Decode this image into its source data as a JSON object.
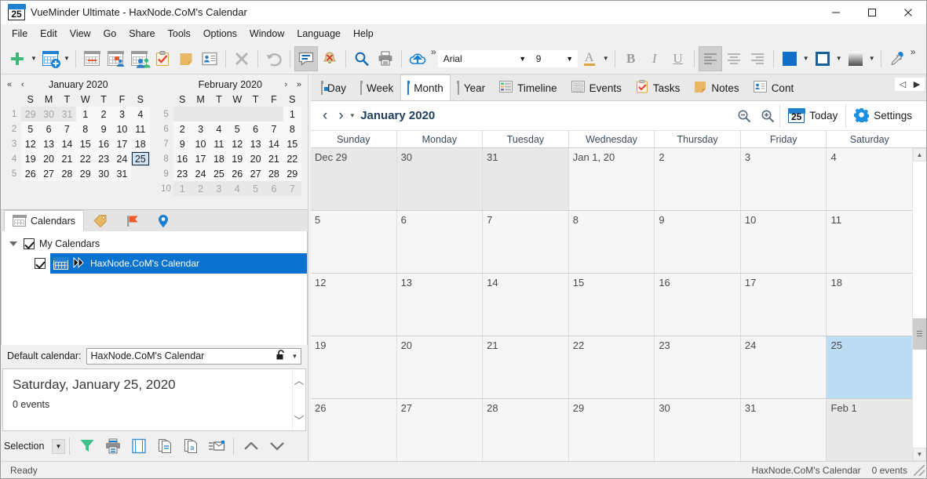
{
  "window": {
    "title": "VueMinder Ultimate - HaxNode.CoM's Calendar",
    "app_icon_number": "25",
    "minimize": "—",
    "maximize": "☐",
    "close": "✕"
  },
  "menu": {
    "items": [
      "File",
      "Edit",
      "View",
      "Go",
      "Share",
      "Tools",
      "Options",
      "Window",
      "Language",
      "Help"
    ]
  },
  "toolbar": {
    "font_name": "Arial",
    "font_size": "9",
    "overflow_label": "»",
    "buttons": [
      {
        "name": "new-item-button",
        "icon": "plus-icon"
      },
      {
        "name": "new-item-dropdown",
        "icon": "chevron-down-icon"
      },
      {
        "name": "new-calendar-button",
        "icon": "calendar-add-icon"
      },
      {
        "name": "new-calendar-dropdown",
        "icon": "chevron-down-icon"
      },
      {
        "name": "new-event-button",
        "icon": "calendar-event-icon"
      },
      {
        "name": "new-task-button",
        "icon": "calendar-task-icon"
      },
      {
        "name": "new-contact-group-button",
        "icon": "calendar-people-icon"
      },
      {
        "name": "new-task-list-button",
        "icon": "clipboard-check-icon"
      },
      {
        "name": "new-note-button",
        "icon": "sticky-note-icon"
      },
      {
        "name": "new-contact-button",
        "icon": "contact-card-icon"
      },
      {
        "name": "delete-button",
        "icon": "delete-x-icon"
      },
      {
        "name": "undo-button",
        "icon": "undo-arrow-icon"
      },
      {
        "name": "reminders-button",
        "icon": "speech-balloon-icon"
      },
      {
        "name": "dismiss-alarm-button",
        "icon": "bell-cancel-icon"
      },
      {
        "name": "search-button",
        "icon": "magnifier-icon"
      },
      {
        "name": "print-button",
        "icon": "printer-icon"
      },
      {
        "name": "sync-upload-button",
        "icon": "cloud-upload-icon"
      },
      {
        "name": "font-color-button",
        "icon": "font-color-A-icon"
      },
      {
        "name": "bold-button",
        "icon": "bold-B-icon"
      },
      {
        "name": "italic-button",
        "icon": "italic-I-icon"
      },
      {
        "name": "underline-button",
        "icon": "underline-U-icon"
      },
      {
        "name": "align-left-button",
        "icon": "align-left-icon"
      },
      {
        "name": "align-center-button",
        "icon": "align-center-icon"
      },
      {
        "name": "align-right-button",
        "icon": "align-right-icon"
      },
      {
        "name": "fill-color-button",
        "icon": "fill-color-swatch-icon"
      },
      {
        "name": "border-color-button",
        "icon": "border-color-swatch-icon"
      },
      {
        "name": "gradient-button",
        "icon": "gradient-swatch-icon"
      },
      {
        "name": "eyedropper-button",
        "icon": "eyedropper-icon"
      }
    ],
    "labels": {
      "bold": "B",
      "italic": "I",
      "underline": "U",
      "font_color": "A"
    }
  },
  "minicalendars": {
    "nav": {
      "prev_year": "«",
      "prev_month": "‹",
      "next_month": "›",
      "next_year": "»"
    },
    "dow": [
      "S",
      "M",
      "T",
      "W",
      "T",
      "F",
      "S"
    ],
    "months": [
      {
        "title": "January 2020",
        "weeks": [
          {
            "num": "1",
            "days": [
              {
                "t": "29",
                "s": "other"
              },
              {
                "t": "30",
                "s": "other"
              },
              {
                "t": "31",
                "s": "other"
              },
              {
                "t": "1",
                "s": "d"
              },
              {
                "t": "2",
                "s": "d"
              },
              {
                "t": "3",
                "s": "d"
              },
              {
                "t": "4",
                "s": "d"
              }
            ]
          },
          {
            "num": "2",
            "days": [
              {
                "t": "5",
                "s": "d"
              },
              {
                "t": "6",
                "s": "d"
              },
              {
                "t": "7",
                "s": "d"
              },
              {
                "t": "8",
                "s": "d"
              },
              {
                "t": "9",
                "s": "d"
              },
              {
                "t": "10",
                "s": "d"
              },
              {
                "t": "11",
                "s": "d"
              }
            ]
          },
          {
            "num": "3",
            "days": [
              {
                "t": "12",
                "s": "d"
              },
              {
                "t": "13",
                "s": "d"
              },
              {
                "t": "14",
                "s": "d"
              },
              {
                "t": "15",
                "s": "d"
              },
              {
                "t": "16",
                "s": "d"
              },
              {
                "t": "17",
                "s": "d"
              },
              {
                "t": "18",
                "s": "d"
              }
            ]
          },
          {
            "num": "4",
            "days": [
              {
                "t": "19",
                "s": "d"
              },
              {
                "t": "20",
                "s": "d"
              },
              {
                "t": "21",
                "s": "d"
              },
              {
                "t": "22",
                "s": "d"
              },
              {
                "t": "23",
                "s": "d"
              },
              {
                "t": "24",
                "s": "d"
              },
              {
                "t": "25",
                "s": "today"
              }
            ]
          },
          {
            "num": "5",
            "days": [
              {
                "t": "26",
                "s": "d"
              },
              {
                "t": "27",
                "s": "d"
              },
              {
                "t": "28",
                "s": "d"
              },
              {
                "t": "29",
                "s": "d"
              },
              {
                "t": "30",
                "s": "d"
              },
              {
                "t": "31",
                "s": "d"
              },
              {
                "t": "",
                "s": "empty"
              }
            ]
          }
        ]
      },
      {
        "title": "February 2020",
        "weeks": [
          {
            "num": "5",
            "days": [
              {
                "t": "",
                "s": "blank"
              },
              {
                "t": "",
                "s": "blank"
              },
              {
                "t": "",
                "s": "blank"
              },
              {
                "t": "",
                "s": "blank"
              },
              {
                "t": "",
                "s": "blank"
              },
              {
                "t": "",
                "s": "blank"
              },
              {
                "t": "1",
                "s": "d"
              }
            ]
          },
          {
            "num": "6",
            "days": [
              {
                "t": "2",
                "s": "d"
              },
              {
                "t": "3",
                "s": "d"
              },
              {
                "t": "4",
                "s": "d"
              },
              {
                "t": "5",
                "s": "d"
              },
              {
                "t": "6",
                "s": "d"
              },
              {
                "t": "7",
                "s": "d"
              },
              {
                "t": "8",
                "s": "d"
              }
            ]
          },
          {
            "num": "7",
            "days": [
              {
                "t": "9",
                "s": "d"
              },
              {
                "t": "10",
                "s": "d"
              },
              {
                "t": "11",
                "s": "d"
              },
              {
                "t": "12",
                "s": "d"
              },
              {
                "t": "13",
                "s": "d"
              },
              {
                "t": "14",
                "s": "d"
              },
              {
                "t": "15",
                "s": "d"
              }
            ]
          },
          {
            "num": "8",
            "days": [
              {
                "t": "16",
                "s": "d"
              },
              {
                "t": "17",
                "s": "d"
              },
              {
                "t": "18",
                "s": "d"
              },
              {
                "t": "19",
                "s": "d"
              },
              {
                "t": "20",
                "s": "d"
              },
              {
                "t": "21",
                "s": "d"
              },
              {
                "t": "22",
                "s": "d"
              }
            ]
          },
          {
            "num": "9",
            "days": [
              {
                "t": "23",
                "s": "d"
              },
              {
                "t": "24",
                "s": "d"
              },
              {
                "t": "25",
                "s": "d"
              },
              {
                "t": "26",
                "s": "d"
              },
              {
                "t": "27",
                "s": "d"
              },
              {
                "t": "28",
                "s": "d"
              },
              {
                "t": "29",
                "s": "d"
              }
            ]
          },
          {
            "num": "10",
            "days": [
              {
                "t": "1",
                "s": "other"
              },
              {
                "t": "2",
                "s": "other"
              },
              {
                "t": "3",
                "s": "other"
              },
              {
                "t": "4",
                "s": "other"
              },
              {
                "t": "5",
                "s": "other"
              },
              {
                "t": "6",
                "s": "other"
              },
              {
                "t": "7",
                "s": "other"
              }
            ]
          }
        ]
      }
    ]
  },
  "calendar_panel": {
    "tabs": [
      {
        "label": "Calendars",
        "icon": "grid-calendar-icon",
        "active": true
      },
      {
        "label": "",
        "icon": "tag-icon",
        "active": false
      },
      {
        "label": "",
        "icon": "flag-icon",
        "active": false
      },
      {
        "label": "",
        "icon": "location-pin-icon",
        "active": false
      }
    ],
    "group_label": "My Calendars",
    "calendar_name": "HaxNode.CoM's Calendar",
    "default_label": "Default calendar:",
    "default_value": "HaxNode.CoM's Calendar"
  },
  "detail": {
    "title": "Saturday, January 25, 2020",
    "events_count": "0 events",
    "selection_label": "Selection",
    "buttons": [
      {
        "name": "filter-button",
        "icon": "funnel-icon"
      },
      {
        "name": "print-button",
        "icon": "printer-icon"
      },
      {
        "name": "print-preview-button",
        "icon": "page-layout-icon"
      },
      {
        "name": "copy-button",
        "icon": "copy-pages-icon"
      },
      {
        "name": "export-button",
        "icon": "export-page-a-icon"
      },
      {
        "name": "email-button",
        "icon": "envelope-list-icon"
      },
      {
        "name": "scroll-up-button",
        "icon": "chevron-up-icon"
      },
      {
        "name": "scroll-down-button",
        "icon": "chevron-down-icon"
      }
    ]
  },
  "view_tabs": [
    {
      "label": "Day",
      "icon": "day-view-icon",
      "active": false
    },
    {
      "label": "Week",
      "icon": "week-view-icon",
      "active": false
    },
    {
      "label": "Month",
      "icon": "month-view-icon",
      "active": true
    },
    {
      "label": "Year",
      "icon": "year-view-icon",
      "active": false
    },
    {
      "label": "Timeline",
      "icon": "timeline-view-icon",
      "active": false
    },
    {
      "label": "Events",
      "icon": "events-list-icon",
      "active": false
    },
    {
      "label": "Tasks",
      "icon": "tasks-clipboard-icon",
      "active": false
    },
    {
      "label": "Notes",
      "icon": "notes-sticky-icon",
      "active": false
    },
    {
      "label": "Cont",
      "icon": "contacts-card-icon",
      "active": false
    }
  ],
  "view_tab_scroll": {
    "left": "◁",
    "right": "▶"
  },
  "navbar": {
    "prev": "‹",
    "next": "›",
    "dropdown": "▾",
    "title": "January 2020",
    "zoom_out": "zoom-out-icon",
    "zoom_in": "zoom-in-icon",
    "today_label": "Today",
    "today_number": "25",
    "settings_label": "Settings"
  },
  "month_grid": {
    "day_headers": [
      "Sunday",
      "Monday",
      "Tuesday",
      "Wednesday",
      "Thursday",
      "Friday",
      "Saturday"
    ],
    "weeks": [
      [
        {
          "t": "Dec 29",
          "s": "off"
        },
        {
          "t": "30",
          "s": "off"
        },
        {
          "t": "31",
          "s": "off"
        },
        {
          "t": "Jan 1, 20",
          "s": "in"
        },
        {
          "t": "2",
          "s": "in"
        },
        {
          "t": "3",
          "s": "in"
        },
        {
          "t": "4",
          "s": "in"
        }
      ],
      [
        {
          "t": "5",
          "s": "in"
        },
        {
          "t": "6",
          "s": "in"
        },
        {
          "t": "7",
          "s": "in"
        },
        {
          "t": "8",
          "s": "in"
        },
        {
          "t": "9",
          "s": "in"
        },
        {
          "t": "10",
          "s": "in"
        },
        {
          "t": "11",
          "s": "in"
        }
      ],
      [
        {
          "t": "12",
          "s": "in"
        },
        {
          "t": "13",
          "s": "in"
        },
        {
          "t": "14",
          "s": "in"
        },
        {
          "t": "15",
          "s": "in"
        },
        {
          "t": "16",
          "s": "in"
        },
        {
          "t": "17",
          "s": "in"
        },
        {
          "t": "18",
          "s": "in"
        }
      ],
      [
        {
          "t": "19",
          "s": "in"
        },
        {
          "t": "20",
          "s": "in"
        },
        {
          "t": "21",
          "s": "in"
        },
        {
          "t": "22",
          "s": "in"
        },
        {
          "t": "23",
          "s": "in"
        },
        {
          "t": "24",
          "s": "in"
        },
        {
          "t": "25",
          "s": "today"
        }
      ],
      [
        {
          "t": "26",
          "s": "in"
        },
        {
          "t": "27",
          "s": "in"
        },
        {
          "t": "28",
          "s": "in"
        },
        {
          "t": "29",
          "s": "in"
        },
        {
          "t": "30",
          "s": "in"
        },
        {
          "t": "31",
          "s": "in"
        },
        {
          "t": "Feb 1",
          "s": "off"
        }
      ]
    ]
  },
  "statusbar": {
    "ready": "Ready",
    "calendar": "HaxNode.CoM's Calendar",
    "events": "0 events"
  },
  "colors": {
    "accent": "#0b72cf",
    "today_cell": "#bcdcf3",
    "selection": "#0b72cf",
    "title_blue": "#23405e"
  }
}
